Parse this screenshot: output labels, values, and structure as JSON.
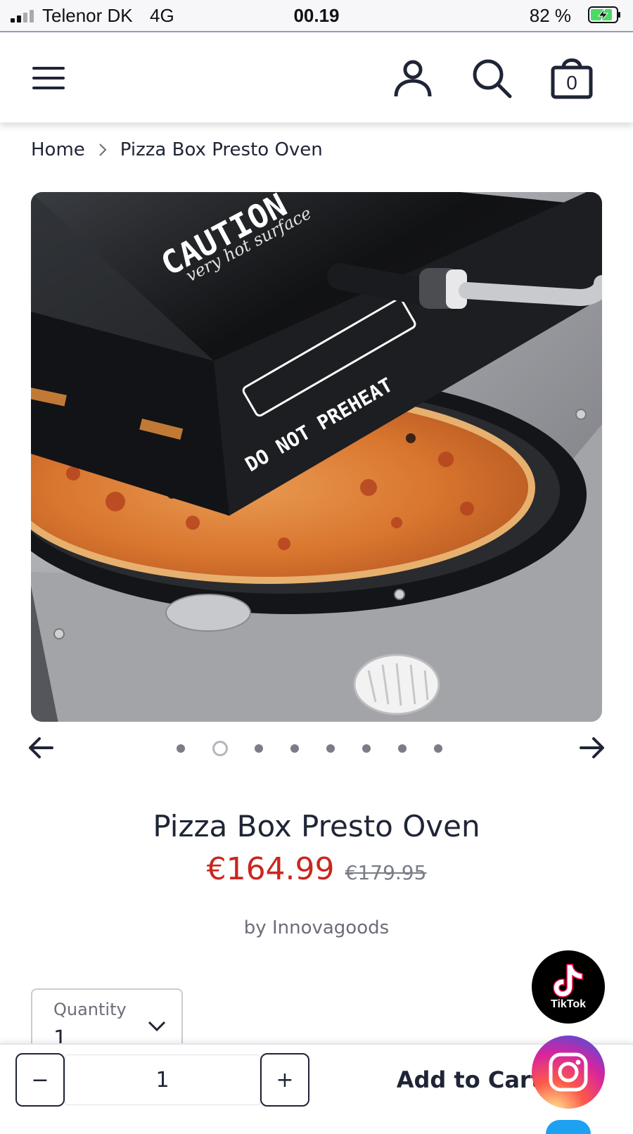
{
  "status_bar": {
    "carrier": "Telenor DK",
    "network": "4G",
    "time": "00.19",
    "battery": "82 %"
  },
  "header": {
    "icons": [
      "menu-icon",
      "account-icon",
      "search-icon",
      "cart-icon"
    ],
    "cart_count": "0"
  },
  "breadcrumb": {
    "home": "Home",
    "current": "Pizza Box Presto Oven"
  },
  "gallery": {
    "image_alt": "Pizza Box Presto Oven product photo",
    "dot_count": 8,
    "active_index": 1,
    "box_text_caution": "CAUTION",
    "box_text_hot": "very hot surface",
    "box_text_preheat": "DO NOT PREHEAT"
  },
  "product": {
    "title": "Pizza Box Presto Oven",
    "price_sale": "€164.99",
    "price_compare": "€179.95",
    "vendor_prefix": "by",
    "vendor": "Innovagoods"
  },
  "quantity_select": {
    "label": "Quantity",
    "value": "1"
  },
  "social": {
    "tiktok_label": "TikTok"
  },
  "bottom_bar": {
    "minus": "−",
    "plus": "+",
    "quantity": "1",
    "add_to_cart": "Add to Cart"
  },
  "colors": {
    "text": "#1f2536",
    "sale_price": "#c9271f",
    "muted": "#6b6e78"
  }
}
